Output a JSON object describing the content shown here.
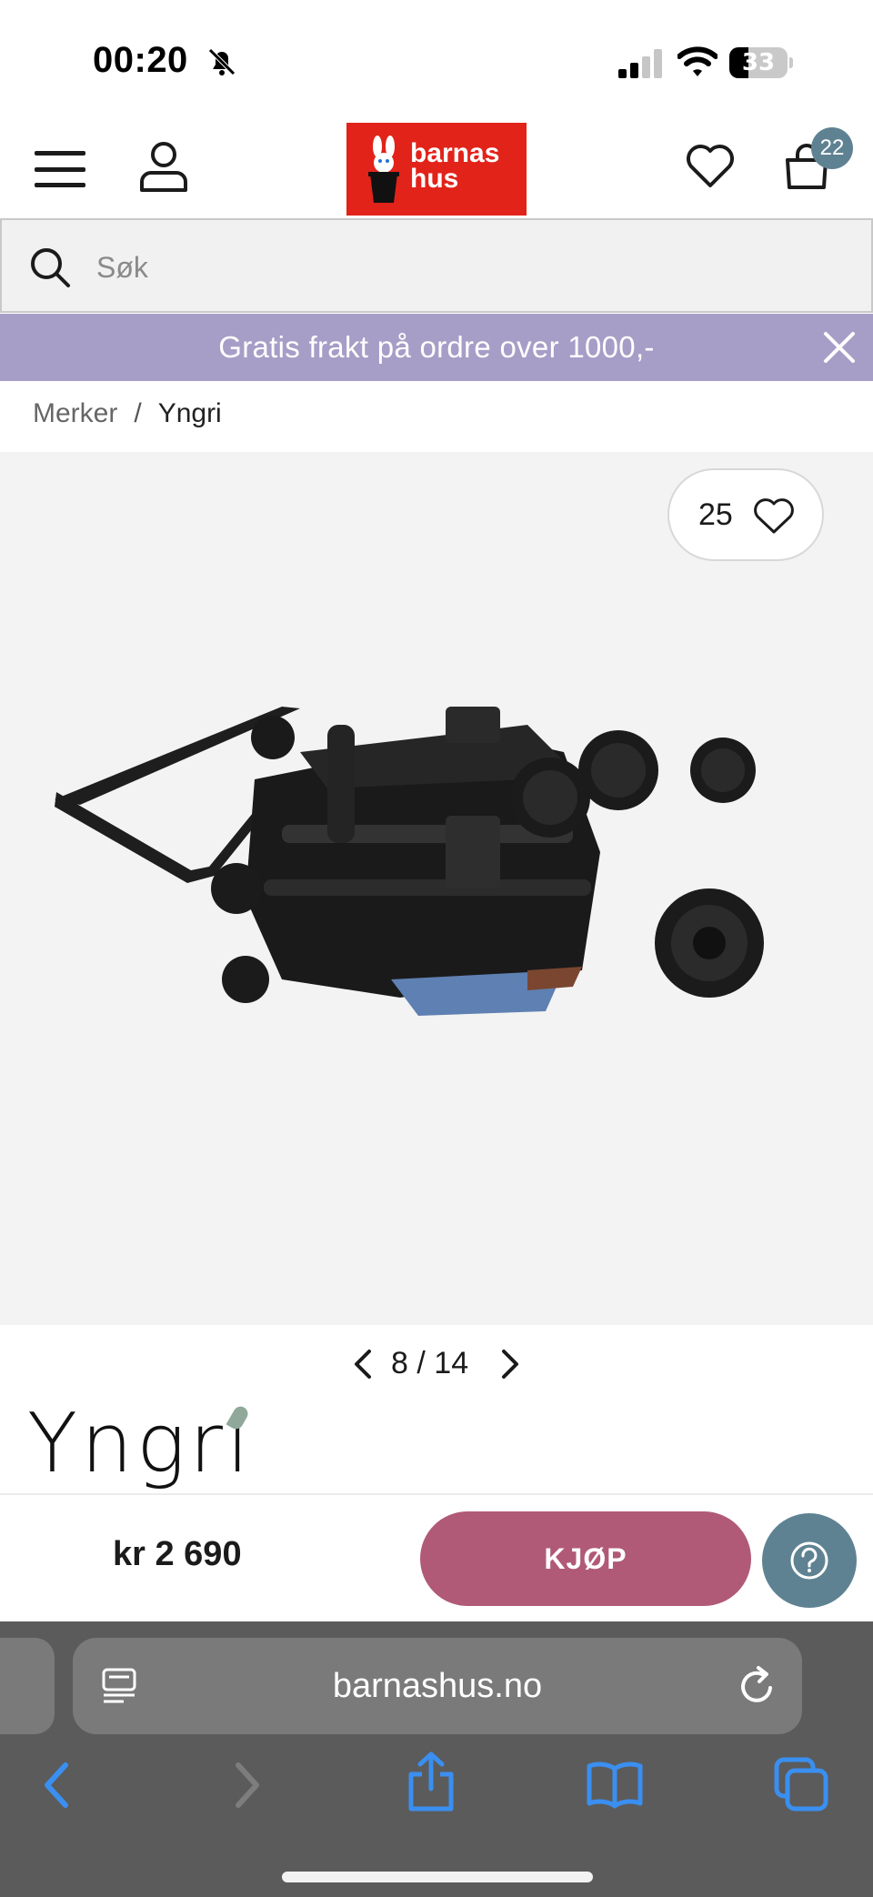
{
  "status_bar": {
    "time": "00:20",
    "battery": "33",
    "battery_level": 0.33
  },
  "header": {
    "logo_line1": "barnas",
    "logo_line2": "hus",
    "cart_count": "22"
  },
  "search": {
    "placeholder": "Søk",
    "value": ""
  },
  "promo": {
    "text": "Gratis frakt på ordre over 1000,-"
  },
  "breadcrumb": {
    "items": [
      "Merker",
      "Yngri"
    ],
    "separator": "/"
  },
  "gallery": {
    "like_count": "25",
    "current": "8",
    "separator": "/",
    "total": "14"
  },
  "brand": {
    "logo_text": "Yngri"
  },
  "buy_bar": {
    "price": "kr 2 690",
    "buy_label": "KJØP"
  },
  "browser": {
    "url": "barnashus.no"
  },
  "colors": {
    "logo_red": "#e2231a",
    "promo_purple": "#a79ec7",
    "buy_pink": "#b05a78",
    "help_blue": "#5f8293",
    "ios_blue": "#3a8ff0"
  }
}
